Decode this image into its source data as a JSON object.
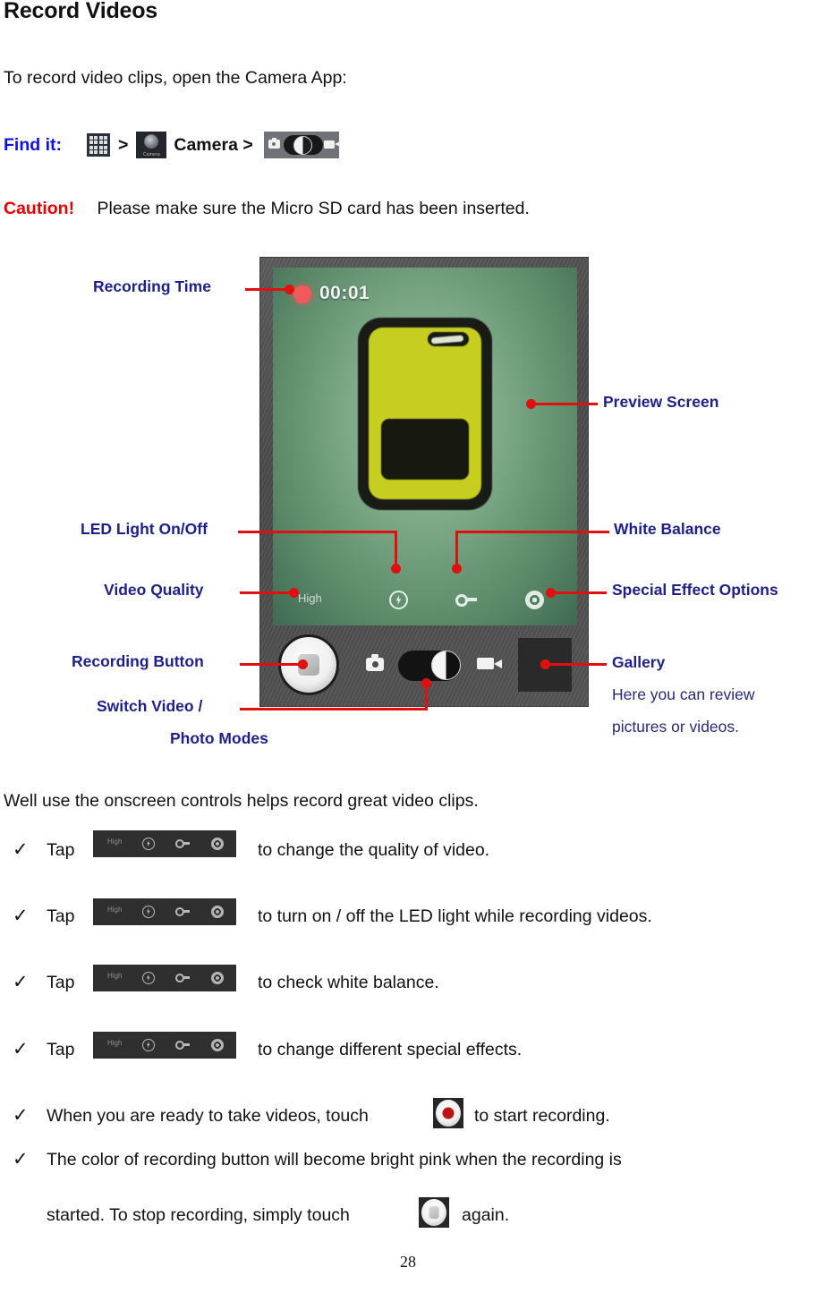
{
  "page": {
    "title": "Record Videos",
    "intro": "To record video clips, open the Camera App:",
    "page_number": "28",
    "label_color": "#1f1f8c",
    "leader_color": "#e01010",
    "caution_color": "#ee0000",
    "findit_color": "#1010ee"
  },
  "findit": {
    "label": "Find it:",
    "app_drawer_icon": "app-drawer-grid-icon",
    "separator1": ">",
    "camera_app_icon": "camera-app-icon",
    "camera_app_icon_label": "Camera",
    "camera_word": "Camera >",
    "mode_toggle_icon": "photo-video-mode-toggle-icon"
  },
  "caution": {
    "word": "Caution!",
    "text": "Please make sure the Micro SD card has been inserted."
  },
  "figure": {
    "device_screen": {
      "recording_time": "00:01",
      "video_quality": "High",
      "rec_indicator": "red-record-dot",
      "flash_icon": "flash-led-icon",
      "white_balance_icon": "white-balance-icon",
      "effects_icon": "special-effects-icon",
      "photo_mode_icon": "camera-mode-icon",
      "video_mode_icon": "video-mode-icon",
      "record_button_icon": "record-stop-button",
      "gallery_thumb_icon": "gallery-thumbnail"
    },
    "callouts": [
      {
        "id": "recording-time",
        "label": "Recording Time"
      },
      {
        "id": "preview-screen",
        "label": "Preview Screen"
      },
      {
        "id": "led-light-on-off",
        "label": "LED Light On/Off"
      },
      {
        "id": "white-balance",
        "label": "White Balance"
      },
      {
        "id": "video-quality",
        "label": "Video Quality"
      },
      {
        "id": "special-effect-options",
        "label": "Special Effect Options"
      },
      {
        "id": "recording-button",
        "label": "Recording Button"
      },
      {
        "id": "gallery",
        "label": "Gallery"
      },
      {
        "id": "switch-modes-line1",
        "label": "Switch Video /"
      },
      {
        "id": "switch-modes-line2",
        "label": "Photo Modes"
      }
    ],
    "gallery_note_line1": "Here you can review",
    "gallery_note_line2": "pictures or videos."
  },
  "instructions": {
    "lead_in": "Well use the onscreen controls helps record great video clips.",
    "items": [
      {
        "check": "✓",
        "prefix": "Tap",
        "icon": "control-strip-icon",
        "suffix": "to change the quality of video."
      },
      {
        "check": "✓",
        "prefix": "Tap",
        "icon": "control-strip-icon",
        "suffix": "to turn on / off the LED light while recording videos."
      },
      {
        "check": "✓",
        "prefix": "Tap",
        "icon": "control-strip-icon",
        "suffix": "to check white balance."
      },
      {
        "check": "✓",
        "prefix": "Tap",
        "icon": "control-strip-icon",
        "suffix": "to change different special effects."
      }
    ],
    "item5": {
      "check": "✓",
      "prefix": "When you are ready to take videos, touch",
      "icon": "record-button-icon",
      "suffix": "to start recording."
    },
    "item6": {
      "check": "✓",
      "line1": "The color of recording button will become bright pink when the recording is",
      "line2_prefix": "started. To stop recording, simply touch",
      "icon": "stop-button-icon",
      "line2_suffix": "again."
    }
  }
}
